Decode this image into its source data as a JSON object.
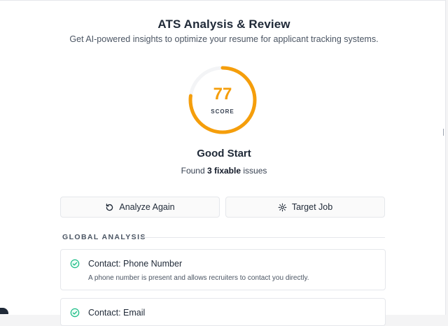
{
  "header": {
    "title": "ATS Analysis & Review",
    "subtitle": "Get AI-powered insights to optimize your resume for applicant tracking systems."
  },
  "score": {
    "value": "77",
    "label": "SCORE",
    "fraction": 0.77,
    "color": "#f59e0b"
  },
  "summary": {
    "status": "Good Start",
    "found_prefix": "Found ",
    "found_count": "3",
    "found_word": " fixable",
    "found_suffix": " issues"
  },
  "actions": {
    "analyze_label": "Analyze Again",
    "analyze_icon": "refresh-icon",
    "target_label": "Target Job",
    "target_icon": "gear-icon"
  },
  "global_analysis": {
    "heading": "GLOBAL ANALYSIS",
    "items": [
      {
        "title": "Contact: Phone Number",
        "description": "A phone number is present and allows recruiters to contact you directly.",
        "status_icon": "check-circle-icon",
        "status_color": "#10b981"
      },
      {
        "title": "Contact: Email",
        "description": "",
        "status_icon": "check-circle-icon",
        "status_color": "#10b981"
      }
    ]
  }
}
